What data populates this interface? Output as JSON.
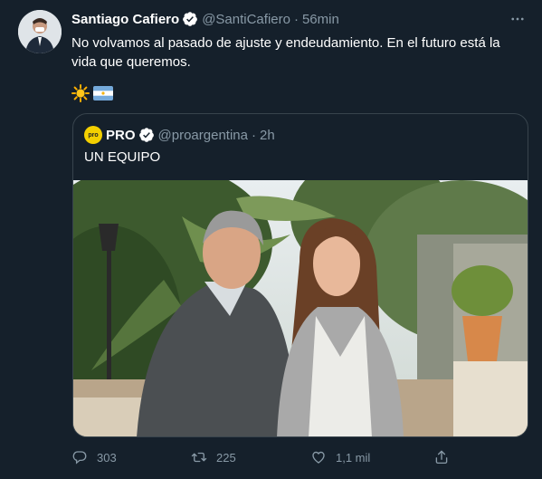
{
  "tweet": {
    "author_name": "Santiago Cafiero",
    "handle": "@SantiCafiero",
    "separator": "·",
    "time": "56min",
    "text": "No volvamos al pasado de ajuste y endeudamiento. En el futuro está la vida que queremos.",
    "emojis": [
      "sun-emoji",
      "argentina-flag-emoji"
    ]
  },
  "quoted": {
    "avatar_text": "pro",
    "author_name": "PRO",
    "handle": "@proargentina",
    "separator": "·",
    "time": "2h",
    "text": "UN EQUIPO"
  },
  "actions": {
    "reply_count": "303",
    "retweet_count": "225",
    "like_count": "1,1 mil"
  },
  "icons": {
    "more": "more-horizontal-icon",
    "verified": "verified-badge-icon",
    "reply": "reply-icon",
    "retweet": "retweet-icon",
    "like": "heart-icon",
    "share": "share-icon"
  },
  "colors": {
    "background": "#15202b",
    "muted_text": "#8899a6",
    "border": "#38444d",
    "verified": "#1da1f2",
    "pro_brand": "#f4d000"
  }
}
